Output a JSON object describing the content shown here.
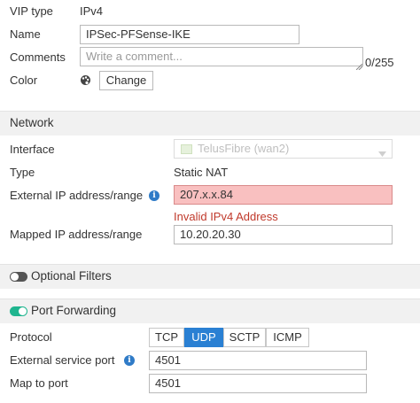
{
  "vip_type": {
    "label": "VIP type",
    "value": "IPv4"
  },
  "name": {
    "label": "Name",
    "value": "IPSec-PFSense-IKE"
  },
  "comments": {
    "label": "Comments",
    "placeholder": "Write a comment...",
    "counter": "0/255"
  },
  "color": {
    "label": "Color",
    "button_label": "Change",
    "icon": "palette-icon"
  },
  "network": {
    "section_title": "Network",
    "interface": {
      "label": "Interface",
      "value": "TelusFibre (wan2)"
    },
    "type": {
      "label": "Type",
      "value": "Static NAT"
    },
    "external_ip": {
      "label": "External IP address/range",
      "value": "207.x.x.84",
      "error": "Invalid IPv4 Address"
    },
    "mapped_ip": {
      "label": "Mapped IP address/range",
      "value": "10.20.20.30"
    }
  },
  "optional_filters": {
    "label": "Optional Filters",
    "enabled": false
  },
  "port_forwarding": {
    "label": "Port Forwarding",
    "enabled": true,
    "protocol": {
      "label": "Protocol",
      "options": [
        "TCP",
        "UDP",
        "SCTP",
        "ICMP"
      ],
      "selected": "UDP"
    },
    "external_service_port": {
      "label": "External service port",
      "value": "4501"
    },
    "map_to_port": {
      "label": "Map to port",
      "value": "4501"
    }
  },
  "colors": {
    "accent": "#2a80d3",
    "toggle_on": "#1fb58f",
    "toggle_off": "#555555",
    "error": "#c0392b",
    "invalid_bg": "#f9c0c0"
  }
}
